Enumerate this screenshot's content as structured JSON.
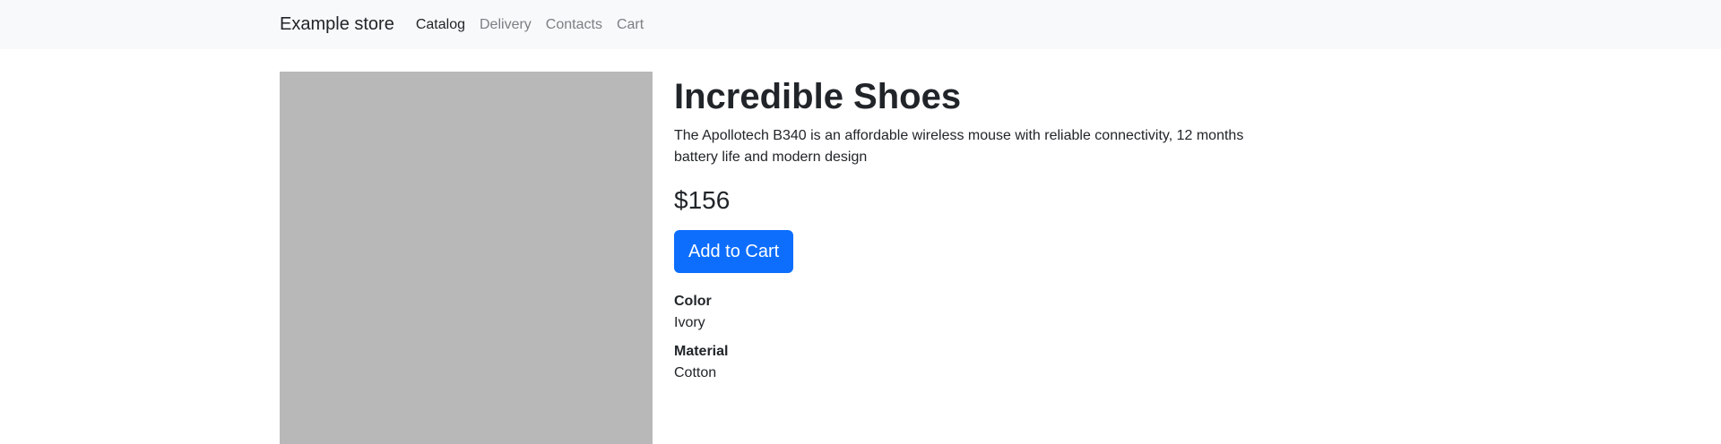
{
  "navbar": {
    "brand": "Example store",
    "links": [
      {
        "label": "Catalog",
        "active": true
      },
      {
        "label": "Delivery",
        "active": false
      },
      {
        "label": "Contacts",
        "active": false
      },
      {
        "label": "Cart",
        "active": false
      }
    ]
  },
  "product": {
    "title": "Incredible Shoes",
    "description": "The Apollotech B340 is an affordable wireless mouse with reliable connectivity, 12 months battery life and modern design",
    "price": "$156",
    "add_to_cart_label": "Add to Cart",
    "specs": [
      {
        "label": "Color",
        "value": "Ivory"
      },
      {
        "label": "Material",
        "value": "Cotton"
      }
    ]
  },
  "colors": {
    "navbar_bg": "#f8f9fa",
    "primary": "#0d6efd",
    "image_placeholder": "#b8b8b8",
    "text": "#212529",
    "muted_link": "#7b7f84"
  }
}
